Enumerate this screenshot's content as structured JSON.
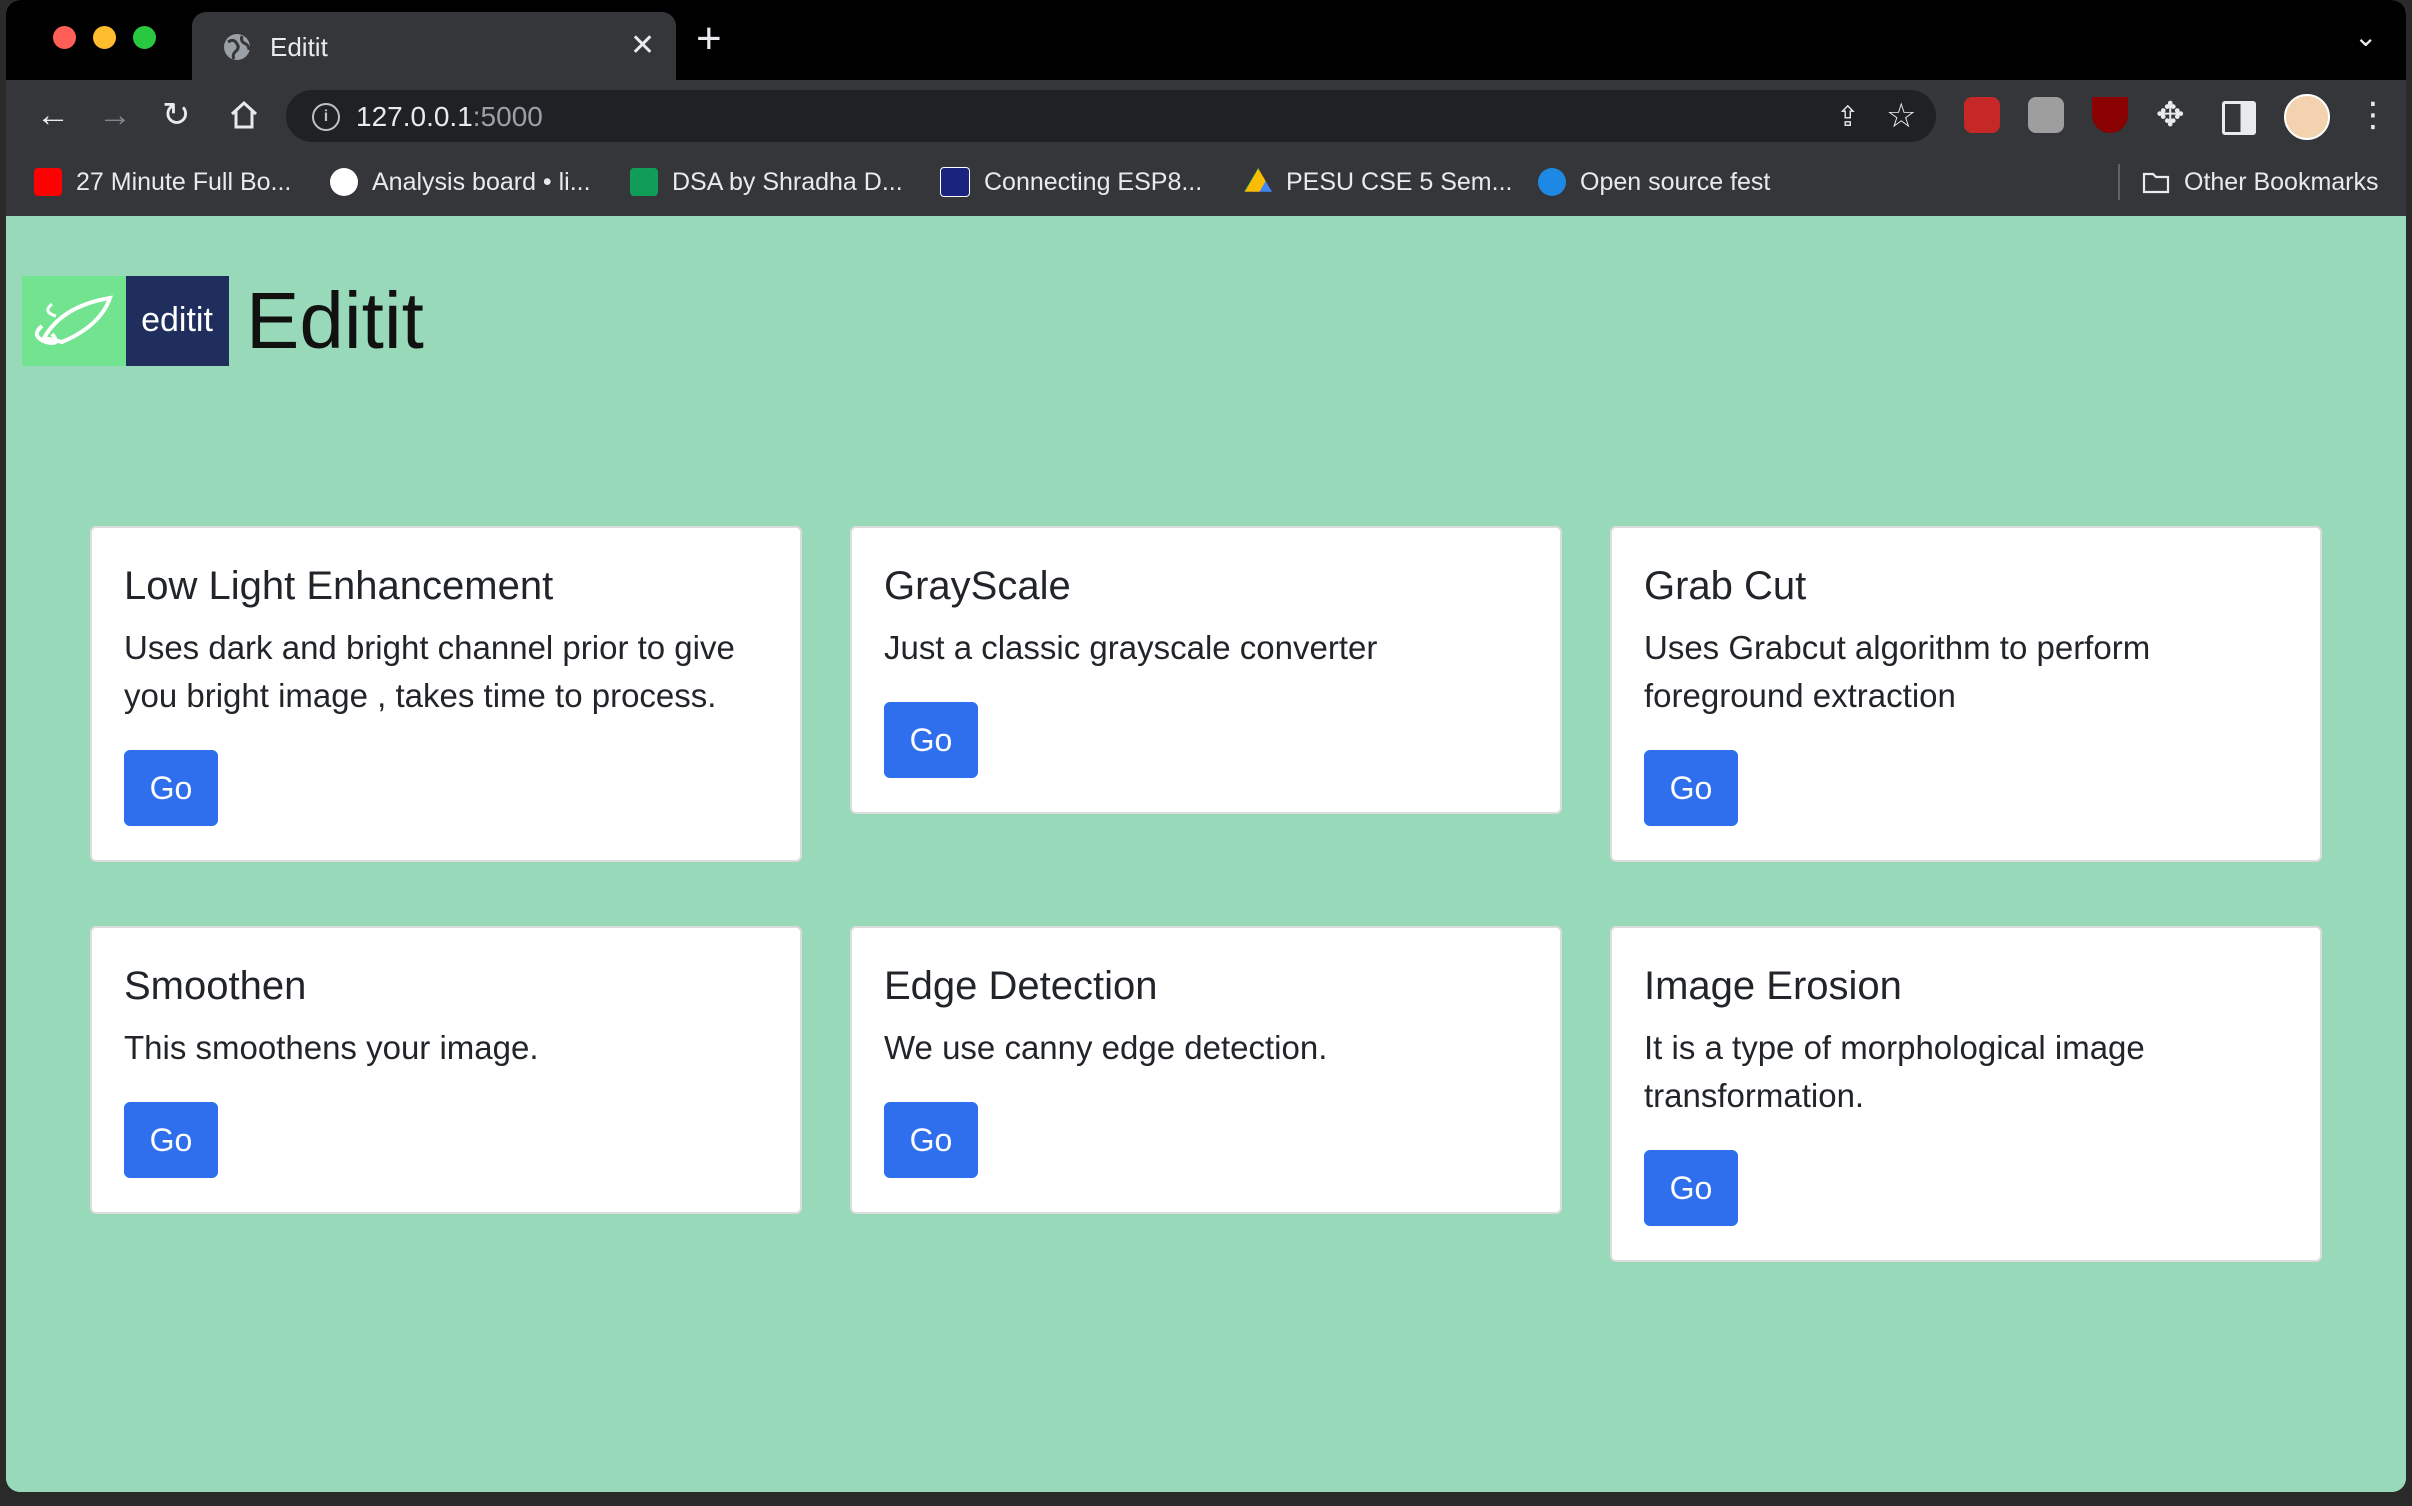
{
  "browser": {
    "tab_title": "Editit",
    "tab_close": "✕",
    "new_tab": "+",
    "tab_menu": "⌄",
    "url_host": "127.0.0.1",
    "url_port": ":5000",
    "bookmarks": [
      {
        "label": "27 Minute Full Bo...",
        "icon": "youtube-icon",
        "color": "#ff0000"
      },
      {
        "label": "Analysis board • li...",
        "icon": "lichess-icon",
        "color": "#ffffff"
      },
      {
        "label": "DSA by Shradha D...",
        "icon": "sheets-icon",
        "color": "#0f9d58"
      },
      {
        "label": "Connecting ESP8...",
        "icon": "site-icon",
        "color": "#1a237e"
      },
      {
        "label": "PESU CSE 5 Sem...",
        "icon": "drive-icon",
        "color": "#fbbc04"
      },
      {
        "label": "Open source fest",
        "icon": "site-icon",
        "color": "#1e88e5"
      }
    ],
    "other_bookmarks": "Other Bookmarks"
  },
  "header": {
    "logo_text": "editit",
    "title": "Editit"
  },
  "cards": [
    {
      "title": "Low Light Enhancement",
      "text": "Uses dark and bright channel prior to give you bright image , takes time to process.",
      "button": "Go"
    },
    {
      "title": "GrayScale",
      "text": "Just a classic grayscale converter",
      "button": "Go"
    },
    {
      "title": "Grab Cut",
      "text": "Uses Grabcut algorithm to perform foreground extraction",
      "button": "Go"
    },
    {
      "title": "Smoothen",
      "text": "This smoothens your image.",
      "button": "Go"
    },
    {
      "title": "Edge Detection",
      "text": "We use canny edge detection.",
      "button": "Go"
    },
    {
      "title": "Image Erosion",
      "text": "It is a type of morphological image transformation.",
      "button": "Go"
    }
  ],
  "colors": {
    "page_background": "#97d9b8",
    "button": "#2f6fed",
    "card": "#ffffff"
  }
}
